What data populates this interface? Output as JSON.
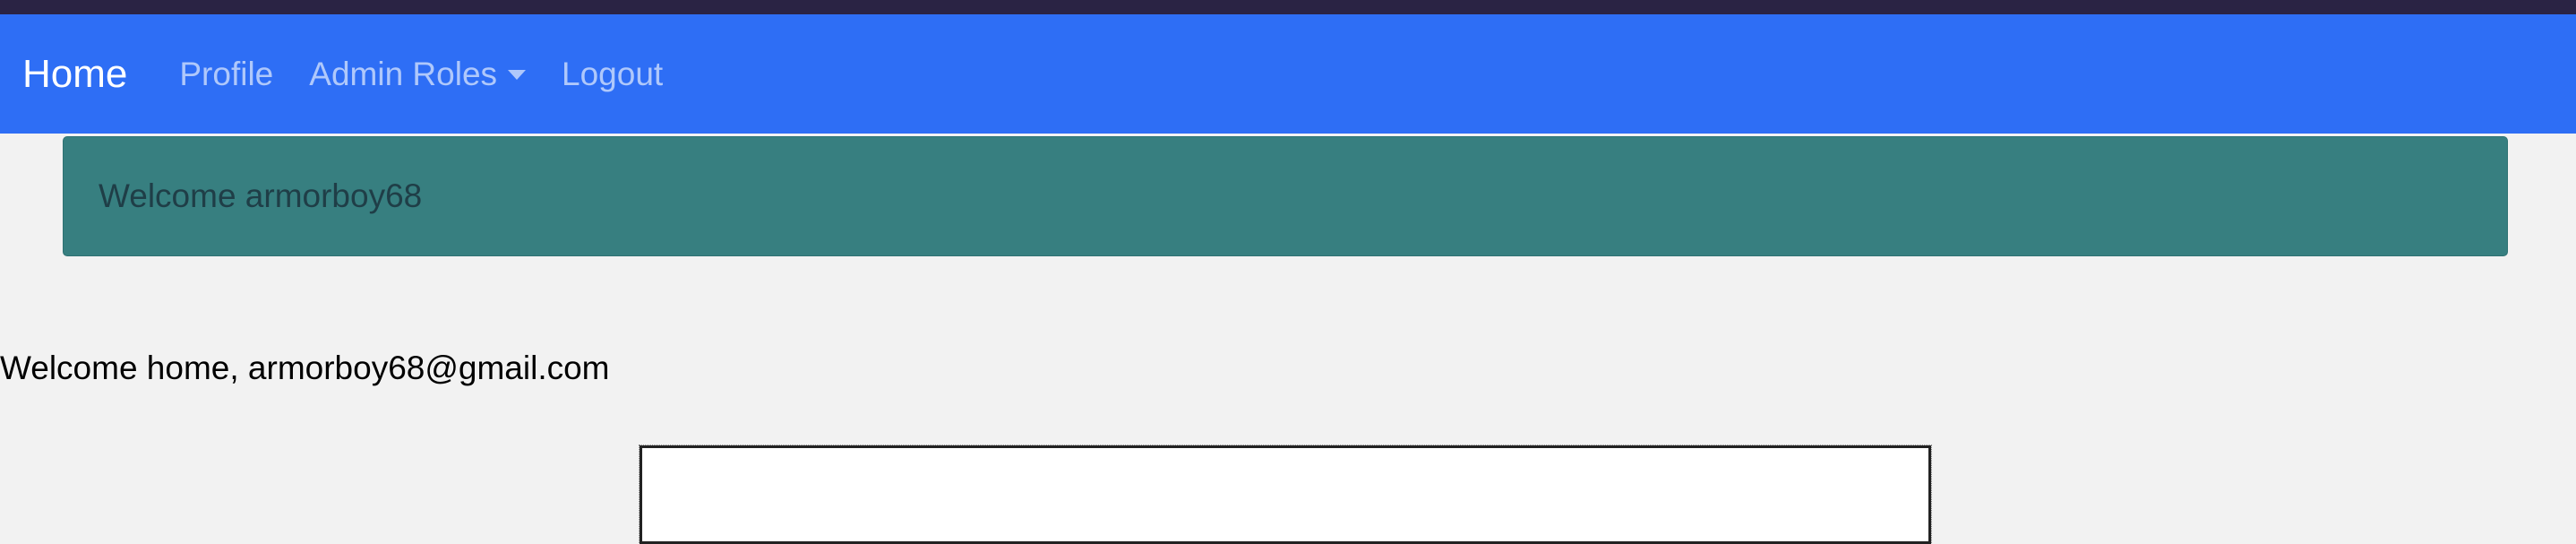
{
  "navbar": {
    "brand": "Home",
    "links": [
      "Profile",
      "Admin Roles",
      "Logout"
    ]
  },
  "alert": {
    "message": "Welcome armorboy68"
  },
  "main": {
    "welcome_text": "Welcome home, armorboy68@gmail.com"
  },
  "colors": {
    "navbar": "#2e6ef5",
    "alert": "#377f80",
    "background": "#f2f2f2"
  }
}
